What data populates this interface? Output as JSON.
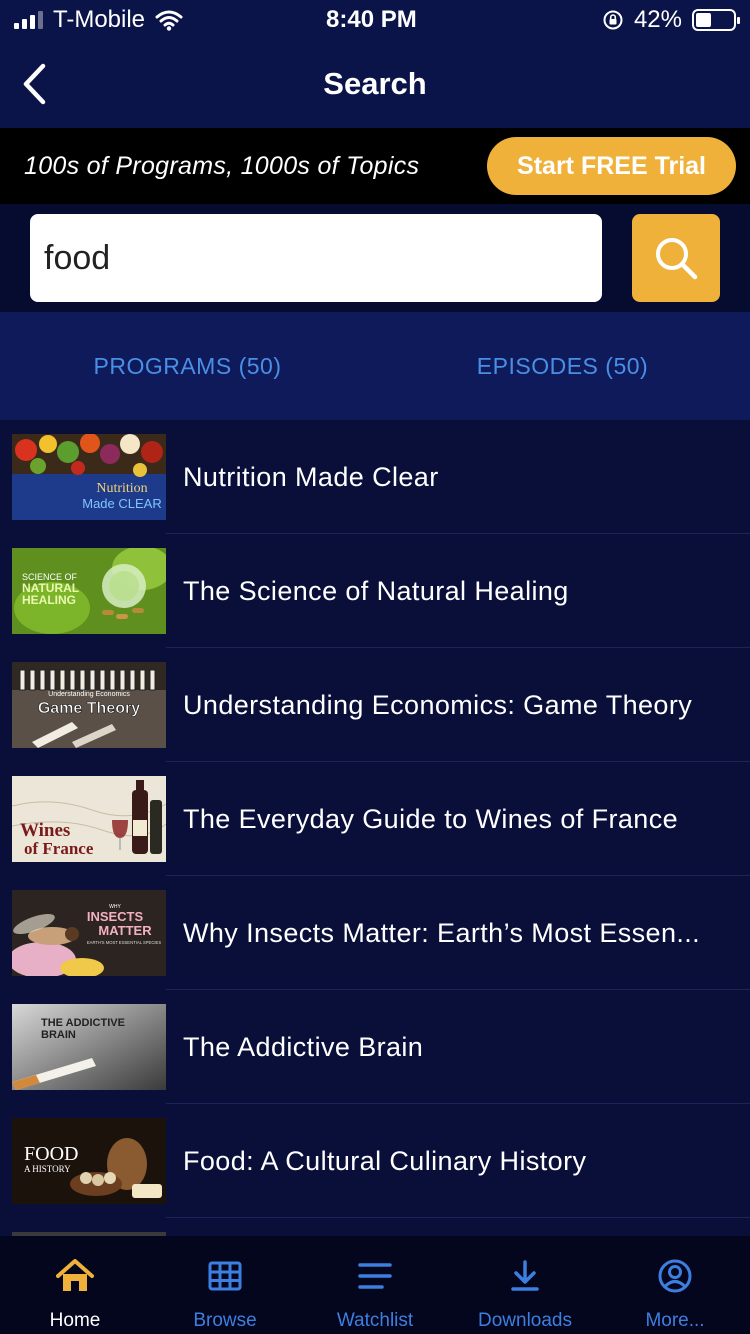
{
  "status": {
    "carrier": "T-Mobile",
    "time": "8:40 PM",
    "battery": "42%",
    "battery_level": 0.42
  },
  "nav": {
    "title": "Search"
  },
  "promo": {
    "text": "100s of Programs, 1000s of Topics",
    "button": "Start FREE Trial"
  },
  "search": {
    "value": "food"
  },
  "tabs": [
    {
      "label": "PROGRAMS (50)"
    },
    {
      "label": "EPISODES (50)"
    }
  ],
  "results": [
    {
      "title": "Nutrition Made Clear",
      "thumb": {
        "lines": [
          "Nutrition",
          "Made CLEAR"
        ],
        "icon": "produce-image"
      }
    },
    {
      "title": "The Science of Natural Healing",
      "thumb": {
        "lines": [
          "SCIENCE OF",
          "NATURAL",
          "HEALING"
        ],
        "icon": "herbs-image"
      }
    },
    {
      "title": "Understanding Economics: Game Theory",
      "thumb": {
        "lines": [
          "Understanding Economics",
          "Game Theory"
        ],
        "icon": "dominoes-image"
      }
    },
    {
      "title": "The Everyday Guide to Wines of France",
      "thumb": {
        "lines": [
          "Wines",
          "of France"
        ],
        "icon": "wine-image"
      }
    },
    {
      "title": "Why Insects Matter: Earth’s Most Essen...",
      "thumb": {
        "lines": [
          "WHY",
          "INSECTS",
          "MATTER",
          "EARTH'S MOST ESSENTIAL SPECIES"
        ],
        "icon": "insect-image"
      }
    },
    {
      "title": "The Addictive Brain",
      "thumb": {
        "lines": [
          "THE ADDICTIVE",
          "BRAIN"
        ],
        "icon": "cigarette-image"
      }
    },
    {
      "title": "Food: A Cultural Culinary History",
      "thumb": {
        "lines": [
          "FOOD",
          "A HISTORY"
        ],
        "icon": "food-still-life-image"
      }
    }
  ],
  "tabbar": [
    {
      "label": "Home",
      "icon": "home-icon"
    },
    {
      "label": "Browse",
      "icon": "grid-icon"
    },
    {
      "label": "Watchlist",
      "icon": "list-icon"
    },
    {
      "label": "Downloads",
      "icon": "download-icon"
    },
    {
      "label": "More...",
      "icon": "profile-icon"
    }
  ],
  "colors": {
    "accent": "#f0b13a",
    "link": "#4a8fe6",
    "background": "#0a0f3a"
  }
}
